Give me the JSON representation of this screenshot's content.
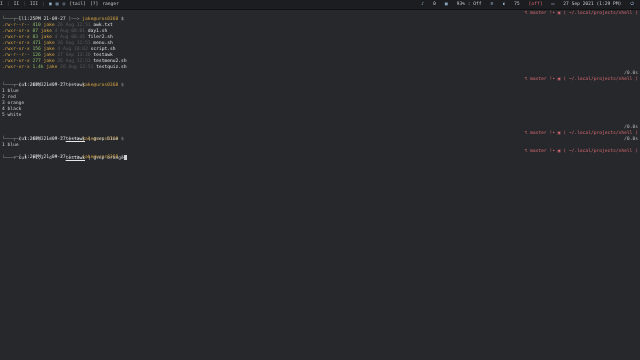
{
  "topbar": {
    "left_items": [
      "I",
      "II",
      "III",
      "[tail]",
      "[?]",
      "ranger"
    ],
    "right_items": [
      "0",
      "93% : Off",
      "75",
      "[off]",
      "27 Sep 2021 (1:29 PM)"
    ],
    "icons": [
      "terminal-icon",
      "folder-icon",
      "browser-icon",
      "bell-icon",
      "cpu-icon",
      "wifi-icon",
      "volume-icon",
      "calendar-icon"
    ]
  },
  "prompt": {
    "user_host": "jake@uros0368",
    "branch": "master",
    "path": "~/.local/projects/shell"
  },
  "blocks": [
    {
      "time": "1:25PM 21-09-27",
      "dir": "$",
      "cmd": "ll",
      "listing": [
        {
          "perm": ".rw-r--r--",
          "size": "410",
          "user": "jake",
          "date": "26 Aug 12:51",
          "name": "awk.txt"
        },
        {
          "perm": ".rwxr-xr-x",
          "size": "87",
          "user": "jake",
          "date": "4 Aug 00:01",
          "name": "day1.sh"
        },
        {
          "perm": ".rwxr-xr-x",
          "size": "83",
          "user": "jake",
          "date": "4 Aug 00:45",
          "name": "filer2.sh"
        },
        {
          "perm": ".rwxr-xr-x",
          "size": "471",
          "user": "jake",
          "date": "26 Aug 12:51",
          "name": "menu.sh"
        },
        {
          "perm": ".rwxr-xr-x",
          "size": "156",
          "user": "jake",
          "date": "4 Aug 10:02",
          "name": "script.sh"
        },
        {
          "perm": ".rw-r--r--",
          "size": "126",
          "user": "jake",
          "date": "27 Sep 13:26",
          "name": "testawk"
        },
        {
          "perm": ".rwxr-xr-x",
          "size": "277",
          "user": "jake",
          "date": "26 Aug 12:51",
          "name": "testmenu2.sh"
        },
        {
          "perm": ".rwxr-xr-x",
          "size": "1.4k",
          "user": "jake",
          "date": "26 Aug 12:51",
          "name": "testquiz.sh"
        }
      ],
      "elapsed": "/0.0s"
    },
    {
      "time": "1:26PM 21-09-27",
      "cmd": "cut -f1,3 -d \" \" testawk",
      "output": [
        "1 blue",
        "2 red",
        "3 orange",
        "4 black",
        "5 white"
      ],
      "elapsed": "/0.0s"
    },
    {
      "time": "1:26PM 21-09-27",
      "cmd_pre": "cut -f1,3 -d \" \"",
      "cmd_file": "testawk",
      "cmd_post": "| grep blue",
      "output": [
        "1 blue"
      ],
      "elapsed": "/0.0s"
    },
    {
      "time": "1:26PM 21-09-27",
      "cmd_pre": "cut -f1,3 -d \" \"",
      "cmd_file": "testawk",
      "cmd_post": "| grep orange",
      "elapsed": ""
    }
  ]
}
